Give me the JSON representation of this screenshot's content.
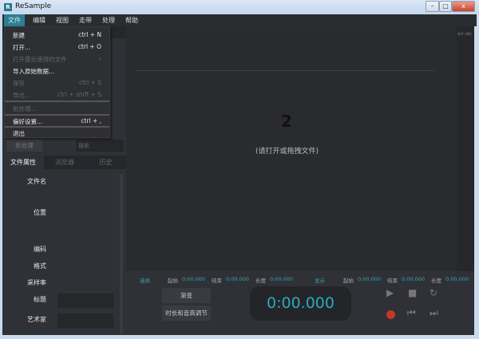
{
  "window": {
    "title": "ReSample",
    "icon_letter": "R",
    "minimize": "–",
    "maximize": "□",
    "close": "x"
  },
  "menubar": [
    "文件",
    "编辑",
    "视图",
    "走带",
    "处理",
    "帮助"
  ],
  "file_menu": [
    {
      "label": "新建",
      "shortcut": "ctrl + N",
      "enabled": true
    },
    {
      "label": "打开...",
      "shortcut": "ctrl + O",
      "enabled": true
    },
    {
      "label": "打开最近使用的文件",
      "shortcut": "›",
      "enabled": false
    },
    {
      "label": "导入原始数据...",
      "shortcut": "",
      "enabled": true
    },
    {
      "label": "保存",
      "shortcut": "ctrl + S",
      "enabled": false
    },
    {
      "label": "导出...",
      "shortcut": "ctrl + shift + S",
      "enabled": false
    },
    {
      "label": "批处理...",
      "shortcut": "",
      "enabled": false
    },
    {
      "label": "偏好设置...",
      "shortcut": "ctrl + ,",
      "enabled": true
    },
    {
      "label": "退出",
      "shortcut": "",
      "enabled": true
    }
  ],
  "left_panel": {
    "batch_button": "批处理",
    "search_placeholder": "搜索",
    "tabs": [
      "文件属性",
      "浏览器",
      "历史"
    ],
    "properties": [
      "文件名",
      "位置",
      "编码",
      "格式",
      "采样率",
      "标题",
      "艺术家"
    ]
  },
  "main": {
    "empty_message": "(请打开或拖拽文件)",
    "meter_label": "电平 (dB)"
  },
  "bottom": {
    "selection_label": "选择",
    "display_label": "显示",
    "start_label": "起始",
    "end_label": "结束",
    "length_label": "长度",
    "sel_start": "0:00.000",
    "sel_end": "0:00.000",
    "sel_length": "0:00.000",
    "disp_start": "0:00.000",
    "disp_end": "0:00.000",
    "disp_length": "0:00.000",
    "fade_button": "渐变",
    "tempo_pitch_button": "时长和音高调节",
    "clock": "0:00.000"
  },
  "colors": {
    "accent": "#2fa8bd",
    "record": "#c0392b"
  }
}
